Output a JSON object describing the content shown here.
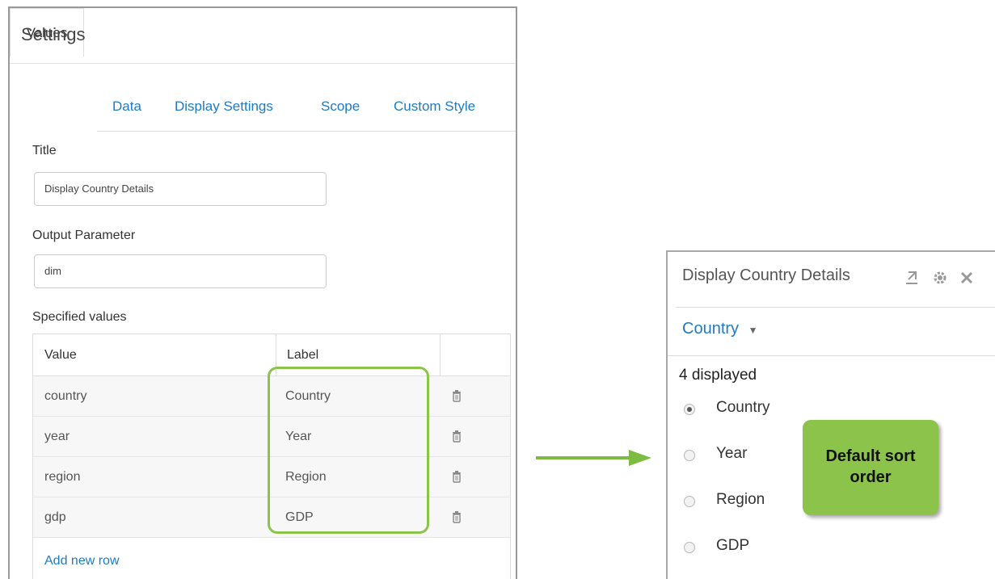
{
  "settings": {
    "title": "Settings",
    "tabs": [
      "Values",
      "Data",
      "Display Settings",
      "Scope",
      "Custom Style"
    ],
    "active_tab": "Values",
    "title_label": "Title",
    "title_value": "Display Country Details",
    "output_parameter_label": "Output Parameter",
    "output_parameter_value": "dim",
    "specified_values_label": "Specified values",
    "table": {
      "headers": [
        "Value",
        "Label"
      ],
      "rows": [
        {
          "value": "country",
          "label": "Country"
        },
        {
          "value": "year",
          "label": "Year"
        },
        {
          "value": "region",
          "label": "Region"
        },
        {
          "value": "gdp",
          "label": "GDP"
        }
      ],
      "add_row": "Add new row"
    }
  },
  "widget": {
    "title": "Display Country Details",
    "selector": "Country",
    "displayed": "4 displayed",
    "options": [
      "Country",
      "Year",
      "Region",
      "GDP"
    ],
    "selected_option": "Country"
  },
  "callout": {
    "line1": "Default sort",
    "line2": "order"
  },
  "colors": {
    "accent_link": "#1f7bc1",
    "highlight_green": "#8cc34a",
    "arrow_green": "#7dbb42"
  }
}
